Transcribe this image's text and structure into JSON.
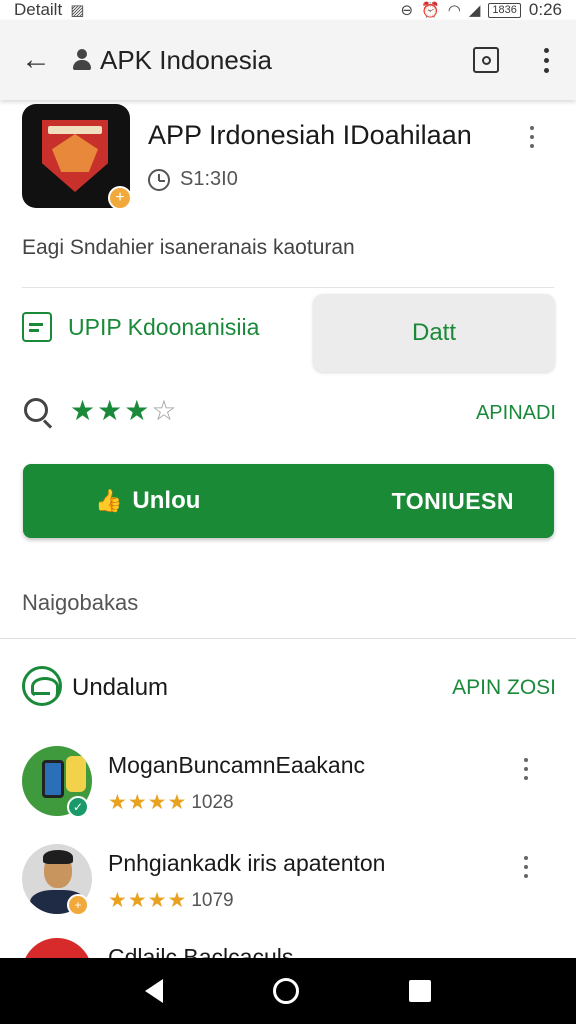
{
  "status_bar": {
    "left_text": "Detailt",
    "time": "0:26",
    "battery": "1836",
    "icons": [
      "image-icon",
      "dnd-icon",
      "alarm-icon",
      "wifi-icon",
      "signal-icon",
      "battery-icon"
    ]
  },
  "app_bar": {
    "title": "APK Indonesia",
    "icons": [
      "back-arrow-icon",
      "person-icon",
      "screenshot-box-icon",
      "more-vert-icon"
    ]
  },
  "app": {
    "name": "APP Irdonesiah IDoahilaan",
    "time": "S1:3I0",
    "description": "Eagi Sndahier isaneranais kaoturan"
  },
  "developer": {
    "name": "UPIP Kdoonanisiia",
    "button_label": "Datt"
  },
  "rating": {
    "stars_filled": 3,
    "stars_total": 4,
    "action": "APINADI"
  },
  "install": {
    "left_label": "Unlou",
    "right_label": "TONIUESN"
  },
  "section_label": "Naigobakas",
  "list": {
    "title": "Undalum",
    "action": "APIN ZOSI",
    "items": [
      {
        "name": "MoganBuncamnEaakanc",
        "stars": "★★★★",
        "count": "1028"
      },
      {
        "name": "Pnhgiankadk iris apatenton",
        "stars": "★★★★",
        "count": "1079"
      }
    ],
    "partial_item": "Cdlailc Baclcaculs"
  },
  "colors": {
    "accent_green": "#1b8a36",
    "star_gold": "#e8a21f",
    "nav_bar": "#000000"
  }
}
